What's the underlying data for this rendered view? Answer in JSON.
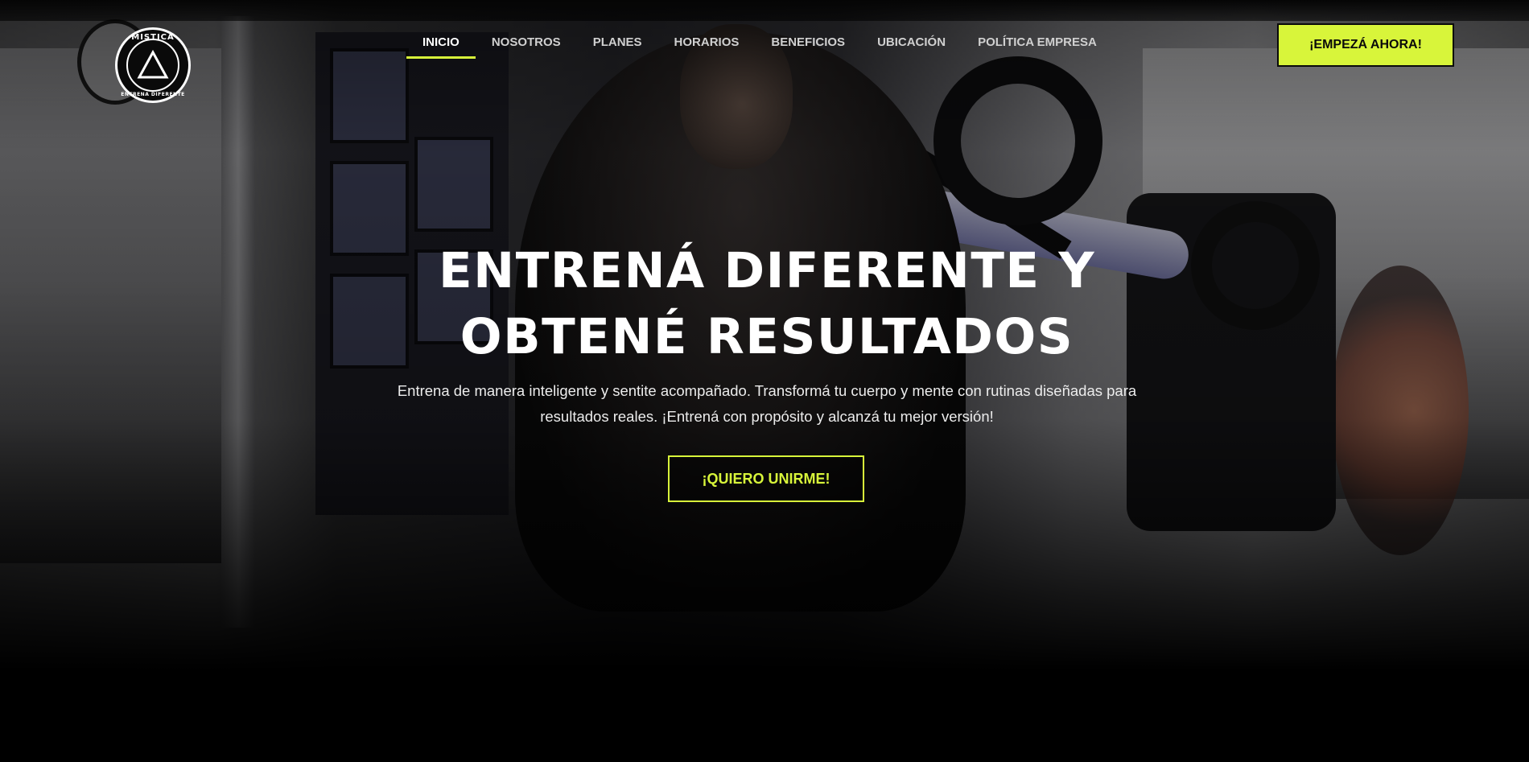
{
  "brand": {
    "logo_top_text": "MISTICA",
    "logo_bottom_text": "ENTRENA DIFERENTE",
    "accent_color": "#d8f53a"
  },
  "nav": {
    "items": [
      {
        "label": "INICIO",
        "active": true
      },
      {
        "label": "NOSOTROS",
        "active": false
      },
      {
        "label": "PLANES",
        "active": false
      },
      {
        "label": "HORARIOS",
        "active": false
      },
      {
        "label": "BENEFICIOS",
        "active": false
      },
      {
        "label": "UBICACIÓN",
        "active": false
      },
      {
        "label": "POLÍTICA EMPRESA",
        "active": false
      }
    ],
    "cta_label": "¡EMPEZÁ AHORA!"
  },
  "hero": {
    "title_line1": "ENTRENÁ DIFERENTE Y",
    "title_line2": "OBTENÉ RESULTADOS",
    "subtitle_line1": "Entrena de manera inteligente y sentite acompañado. Transformá tu cuerpo y mente con rutinas diseñadas para",
    "subtitle_line2": "resultados reales. ¡Entrená con propósito y alcanzá tu mejor versión!",
    "button_label": "¡QUIERO UNIRME!"
  }
}
